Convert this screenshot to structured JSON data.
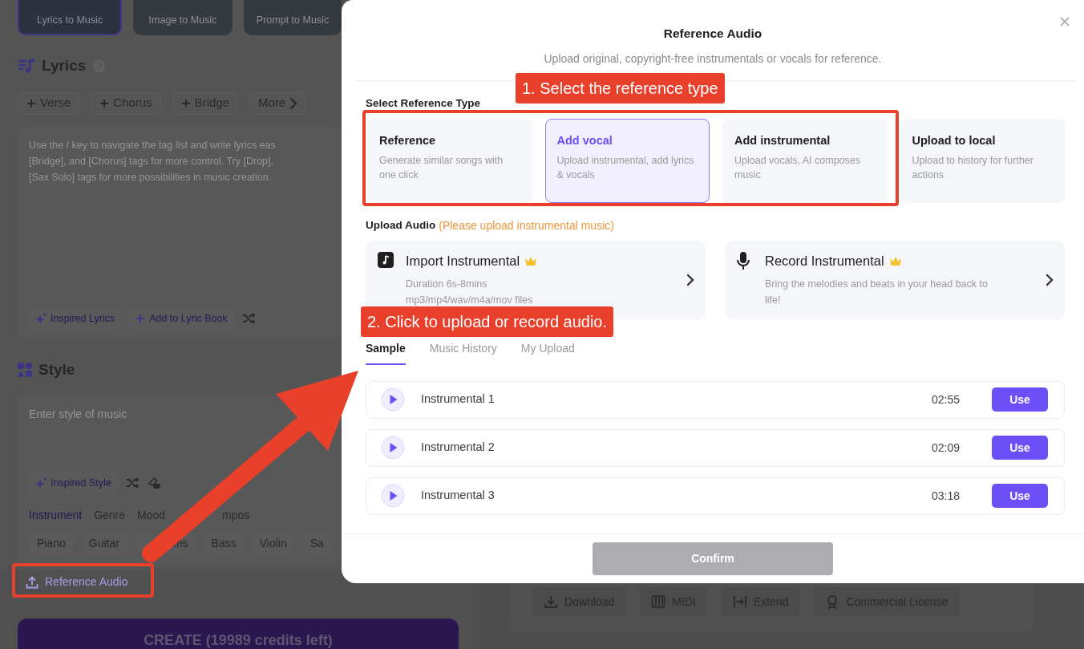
{
  "background": {
    "mode_cards": [
      {
        "label": "Lyrics to Music",
        "selected": true
      },
      {
        "label": "Image to Music",
        "selected": false
      },
      {
        "label": "Prompt to Music",
        "selected": false
      }
    ],
    "lyrics": {
      "title": "Lyrics",
      "tags": [
        "Verse",
        "Chorus",
        "Bridge"
      ],
      "more": "More",
      "placeholder": "Use the / key to navigate the tag list and write lyrics eas\n[Bridge], and [Chorus] tags for more control. Try [Drop],\n[Sax Solo] tags for more possibilities in music creation.",
      "actions": [
        "Inspired Lyrics",
        "Add to Lyric Book"
      ]
    },
    "style": {
      "title": "Style",
      "placeholder": "Enter style of music",
      "inspire": "Inspired Style",
      "tabs": [
        {
          "label": "Instrument",
          "selected": true
        },
        {
          "label": "Genre",
          "selected": false
        },
        {
          "label": "Mood",
          "selected": false
        },
        {
          "label": "mpos",
          "selected": false
        }
      ],
      "chips": [
        "Piano",
        "Guitar",
        "ms",
        "Bass",
        "Violin",
        "Sa"
      ]
    },
    "reference_button": "Reference Audio",
    "create_button": "CREATE (19989 credits left)",
    "result_actions": [
      {
        "kind": "download",
        "label": "Download"
      },
      {
        "kind": "midi",
        "label": "MIDI"
      },
      {
        "kind": "extend",
        "label": "Extend"
      },
      {
        "kind": "license",
        "label": "Commercial License"
      }
    ]
  },
  "modal": {
    "title": "Reference Audio",
    "subtitle": "Upload original, copyright-free instrumentals or vocals for reference.",
    "type_heading": "Select Reference Type",
    "types": [
      {
        "title": "Reference",
        "description": "Generate similar songs with one click",
        "selected": false
      },
      {
        "title": "Add vocal",
        "description": "Upload instrumental, add lyrics & vocals",
        "selected": true
      },
      {
        "title": "Add instrumental",
        "description": "Upload vocals, AI composes music",
        "selected": false
      },
      {
        "title": "Upload to local",
        "description": "Upload to history for further actions",
        "selected": false
      }
    ],
    "upload_heading": "Upload Audio",
    "upload_note": "(Please upload instrumental music)",
    "upload_options": [
      {
        "kind": "import",
        "title": "Import Instrumental",
        "lines": [
          "Duration 6s-8mins",
          "mp3/mp4/wav/m4a/mov files"
        ]
      },
      {
        "kind": "record",
        "title": "Record Instrumental",
        "lines": [
          "Bring the melodies and beats in your head back to",
          "life!"
        ]
      }
    ],
    "tabs": [
      {
        "label": "Sample",
        "selected": true
      },
      {
        "label": "Music History",
        "selected": false
      },
      {
        "label": "My Upload",
        "selected": false
      }
    ],
    "tracks": [
      {
        "name": "Instrumental 1",
        "duration": "02:55",
        "action": "Use"
      },
      {
        "name": "Instrumental 2",
        "duration": "02:09",
        "action": "Use"
      },
      {
        "name": "Instrumental 3",
        "duration": "03:18",
        "action": "Use"
      }
    ],
    "confirm": {
      "label": "Confirm",
      "disabled": true
    }
  },
  "annotations": [
    {
      "text": "1. Select the reference type"
    },
    {
      "text": "2. Click to upload or record audio."
    }
  ]
}
